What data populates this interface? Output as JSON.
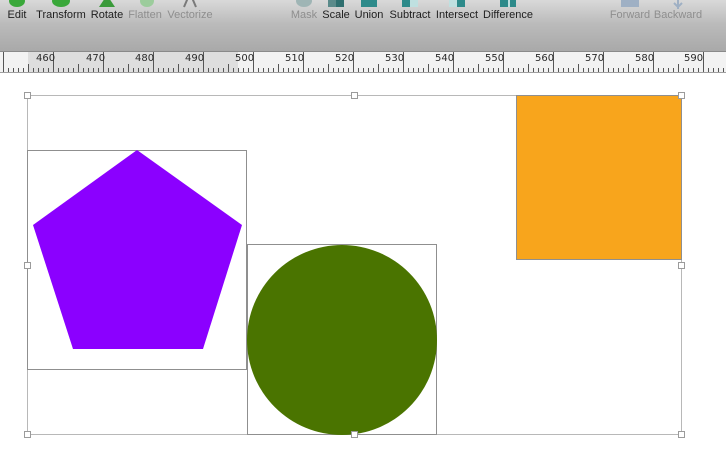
{
  "toolbar": {
    "items": [
      {
        "label": "Edit",
        "icon": "edit-icon",
        "enabled": true
      },
      {
        "label": "Transform",
        "icon": "transform-icon",
        "enabled": true
      },
      {
        "label": "Rotate",
        "icon": "rotate-icon",
        "enabled": true
      },
      {
        "label": "Flatten",
        "icon": "flatten-icon",
        "enabled": false
      },
      {
        "label": "Vectorize",
        "icon": "vectorize-icon",
        "enabled": false
      },
      {
        "label": "Mask",
        "icon": "mask-icon",
        "enabled": false
      },
      {
        "label": "Scale",
        "icon": "scale-icon",
        "enabled": true
      },
      {
        "label": "Union",
        "icon": "union-icon",
        "enabled": true
      },
      {
        "label": "Subtract",
        "icon": "subtract-icon",
        "enabled": true
      },
      {
        "label": "Intersect",
        "icon": "intersect-icon",
        "enabled": true
      },
      {
        "label": "Difference",
        "icon": "difference-icon",
        "enabled": true
      },
      {
        "label": "Forward",
        "icon": "forward-icon",
        "enabled": false
      },
      {
        "label": "Backward",
        "icon": "backward-icon",
        "enabled": false
      }
    ]
  },
  "ruler": {
    "labels": [
      "460",
      "470",
      "480",
      "490",
      "500",
      "510",
      "520",
      "530",
      "540",
      "550",
      "560",
      "570",
      "580",
      "590"
    ]
  },
  "canvas": {
    "shapes": [
      {
        "kind": "pentagon",
        "color": "#8b00ff"
      },
      {
        "kind": "circle",
        "color": "#4a7400"
      },
      {
        "kind": "square",
        "color": "#f8a51c"
      }
    ]
  }
}
